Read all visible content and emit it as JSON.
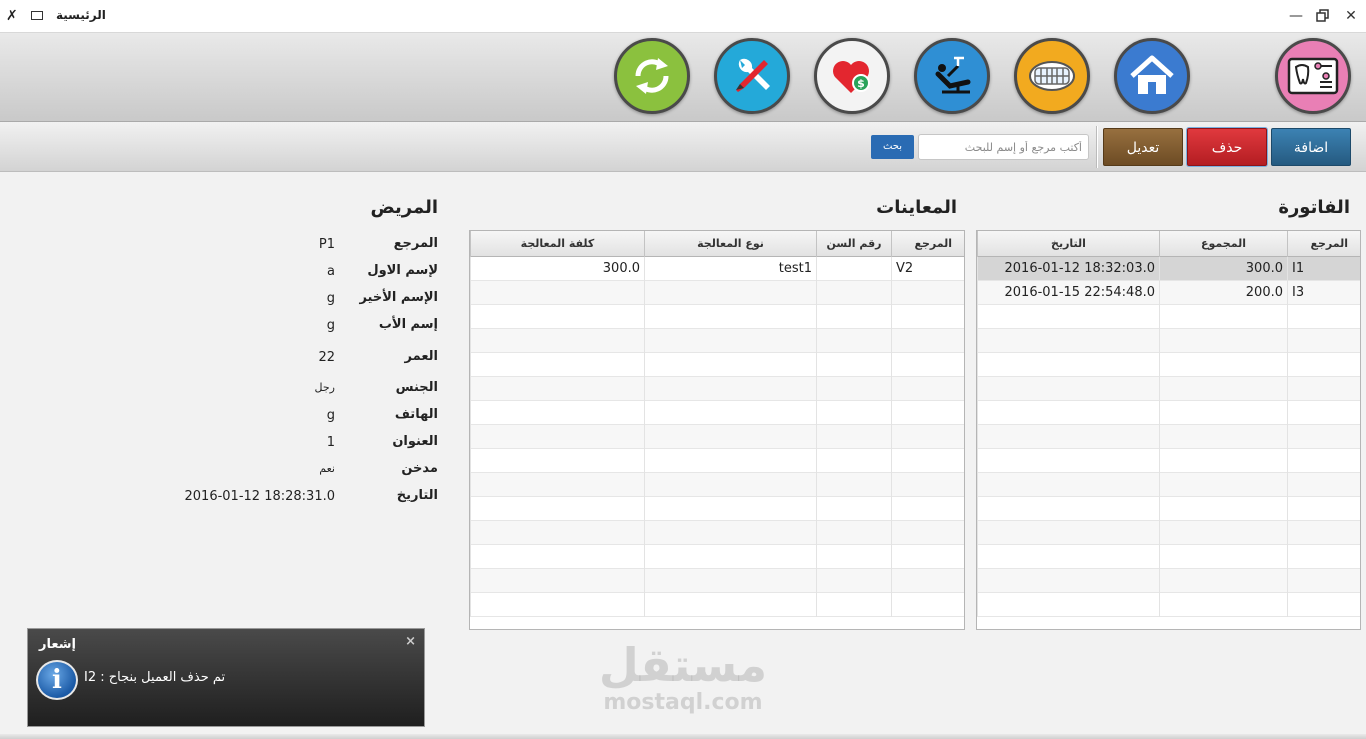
{
  "window": {
    "title": "الرئيسية"
  },
  "toolbar": {
    "buttons": [
      {
        "icon": "tooth-chart-icon",
        "color": "#e97fb5"
      },
      {
        "icon": "home-icon",
        "color": "#3b7bd0"
      },
      {
        "icon": "teeth-icon",
        "color": "#f2aa1f"
      },
      {
        "icon": "dental-chair-icon",
        "color": "#2f8fd4"
      },
      {
        "icon": "heart-money-icon",
        "color": "#f3f3f3"
      },
      {
        "icon": "tools-icon",
        "color": "#24a9d9"
      },
      {
        "icon": "refresh-icon",
        "color": "#8bc13e"
      }
    ]
  },
  "actions": {
    "add": "اضافة",
    "delete": "حذف",
    "edit": "تعديل",
    "search_placeholder": "أكتب مرجع أو إسم للبحث",
    "search_button": "بحث",
    "colors": {
      "add": "#2e6b95",
      "delete": "#c9252b",
      "edit": "#7d5a2e",
      "search": "#2a6bb3"
    }
  },
  "invoice": {
    "title": "الفاتورة",
    "columns": [
      "المرجع",
      "المجموع",
      "التاريخ"
    ],
    "rows": [
      [
        "I1",
        "300.0",
        "2016-01-12 18:32:03.0"
      ],
      [
        "I3",
        "200.0",
        "2016-01-15 22:54:48.0"
      ]
    ]
  },
  "visits": {
    "title": "المعاينات",
    "columns": [
      "المرجع",
      "رقم السن",
      "نوع المعالجة",
      "كلفة المعالجة"
    ],
    "rows": [
      [
        "V2",
        "",
        "test1",
        "300.0"
      ]
    ]
  },
  "patient": {
    "title": "المريض",
    "fields": [
      {
        "label": "المرجع",
        "value": "P1"
      },
      {
        "label": "لإسم الاول",
        "value": "a"
      },
      {
        "label": "الإسم الأخير",
        "value": "g"
      },
      {
        "label": "إسم الأب",
        "value": "g"
      },
      {
        "label": "العمر",
        "value": "22"
      },
      {
        "label": "الجنس",
        "value": "رجل"
      },
      {
        "label": "الهاتف",
        "value": "g"
      },
      {
        "label": "العنوان",
        "value": "1"
      },
      {
        "label": "مدخن",
        "value": "نعم"
      },
      {
        "label": "التاريخ",
        "value": "2016-01-12 18:28:31.0"
      }
    ]
  },
  "notification": {
    "title": "إشعار",
    "message": "تم حذف العميل بنجاح  :  I2",
    "close": "×"
  },
  "watermark": {
    "arabic": "مستقل",
    "latin": "mostaql.com"
  }
}
